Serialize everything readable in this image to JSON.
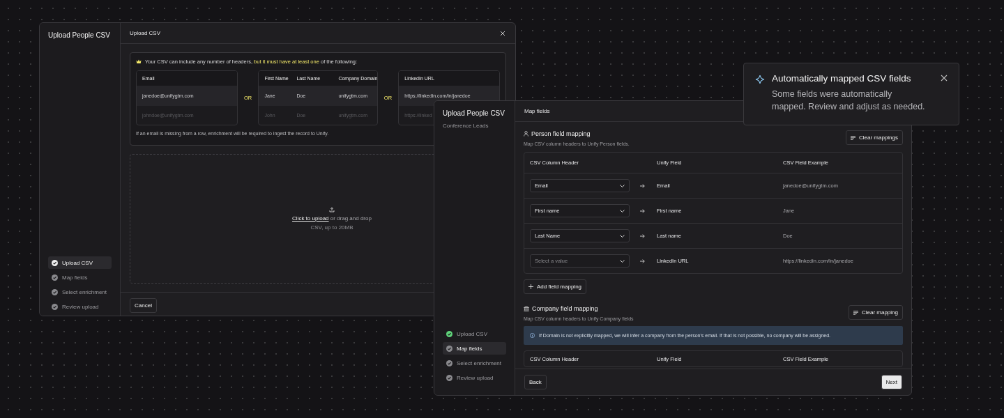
{
  "upload_window": {
    "sidebar_title": "Upload People CSV",
    "steps": [
      {
        "label": "Upload CSV",
        "selected": true,
        "complete": false
      },
      {
        "label": "Map fields",
        "selected": false,
        "complete": false
      },
      {
        "label": "Select enrichment",
        "selected": false,
        "complete": false
      },
      {
        "label": "Review upload",
        "selected": false,
        "complete": false
      }
    ],
    "header": "Upload CSV",
    "notice": "Your CSV can include any number of headers, **but it must have at least one** of the following:",
    "header_options": [
      {
        "kind": "table",
        "columns": [
          "Email"
        ],
        "rows": [
          [
            "janedoe@unifygtm.com"
          ],
          [
            "johndoe@unifygtm.com"
          ]
        ]
      },
      {
        "kind": "separator",
        "label": "OR"
      },
      {
        "kind": "table",
        "columns": [
          "First Name",
          "Last Name",
          "Company Domain"
        ],
        "rows": [
          [
            "Jane",
            "Doe",
            "unifygtm.com"
          ],
          [
            "John",
            "Doe",
            "unifygtm.com"
          ]
        ]
      },
      {
        "kind": "separator",
        "label": "OR"
      },
      {
        "kind": "table",
        "columns": [
          "LinkedIn URL"
        ],
        "rows": [
          [
            "https://linkedin.com/in/janedoe"
          ],
          [
            "https://linked"
          ]
        ]
      }
    ],
    "note": "If an email is missing from a row, enrichment will be required to ingest the record to Unify.",
    "dropzone": {
      "link": "Click to upload",
      "text": "or drag and drop",
      "hint": "CSV, up to 20MB"
    },
    "cancel_button": "Cancel"
  },
  "mapping_window": {
    "sidebar_title": "Upload People CSV",
    "subtitle": "Conference Leads",
    "steps": [
      {
        "label": "Upload CSV",
        "selected": false,
        "complete": true
      },
      {
        "label": "Map fields",
        "selected": true,
        "complete": false
      },
      {
        "label": "Select enrichment",
        "selected": false,
        "complete": false
      },
      {
        "label": "Review upload",
        "selected": false,
        "complete": false
      }
    ],
    "header": "Map fields",
    "person_section": {
      "title": "Person field mapping",
      "description": "Map CSV column headers to Unify Person fields.",
      "clear_button": "Clear mappings",
      "columns": [
        "CSV Column Header",
        "Unify Field",
        "CSV Field Example"
      ],
      "rows": [
        {
          "value": "Email",
          "field": "Email",
          "example": "janedoe@unifygtm.com"
        },
        {
          "value": "First name",
          "field": "First name",
          "example": "Jane"
        },
        {
          "value": "Last Name",
          "field": "Last name",
          "example": "Doe"
        },
        {
          "placeholder": "Select a value",
          "field": "LinkedIn URL",
          "example": "https://linkedin.com/in/janedoe"
        }
      ],
      "add_button": "Add field mapping"
    },
    "company_section": {
      "title": "Company field mapping",
      "description": "Map CSV column headers to Unify Company fields",
      "clear_button": "Clear mapping",
      "info": "If Domain is not explicitly mapped, we will infer a company from the person's email. If that is not possible, no company will be assigned.",
      "columns": [
        "CSV Column Header",
        "Unify Field",
        "CSV Field Example"
      ]
    },
    "back_button": "Back",
    "next_button": "Next"
  },
  "toast": {
    "title": "Automatically mapped CSV fields",
    "message": "Some fields were automatically mapped. Review and adjust as needed."
  }
}
